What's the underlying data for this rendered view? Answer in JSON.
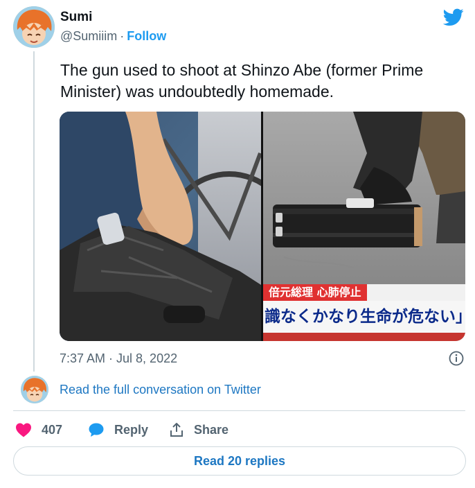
{
  "author": {
    "name": "Sumi",
    "handle": "@Sumiiim",
    "separator": "·",
    "follow_label": "Follow"
  },
  "tweet": {
    "text": "The gun used to shoot at Shinzo Abe (former Prime Minister) was undoubtedly homemade.",
    "timestamp": "7:37 AM · Jul 8, 2022"
  },
  "media": {
    "news_caption_top": "倍元総理 心肺停止",
    "news_caption_main": "識なくかなり生命が危ない」と"
  },
  "conversation": {
    "link_label": "Read the full conversation on Twitter"
  },
  "actions": {
    "likes_count": "407",
    "reply_label": "Reply",
    "share_label": "Share",
    "read_replies_label": "Read 20 replies"
  },
  "colors": {
    "brand_blue": "#1d9bf0",
    "like_red": "#f91880",
    "link_blue": "#1d77c2",
    "muted": "#536471"
  },
  "icons": [
    "twitter-bird-icon",
    "info-icon",
    "heart-icon",
    "speech-bubble-icon",
    "share-icon"
  ]
}
